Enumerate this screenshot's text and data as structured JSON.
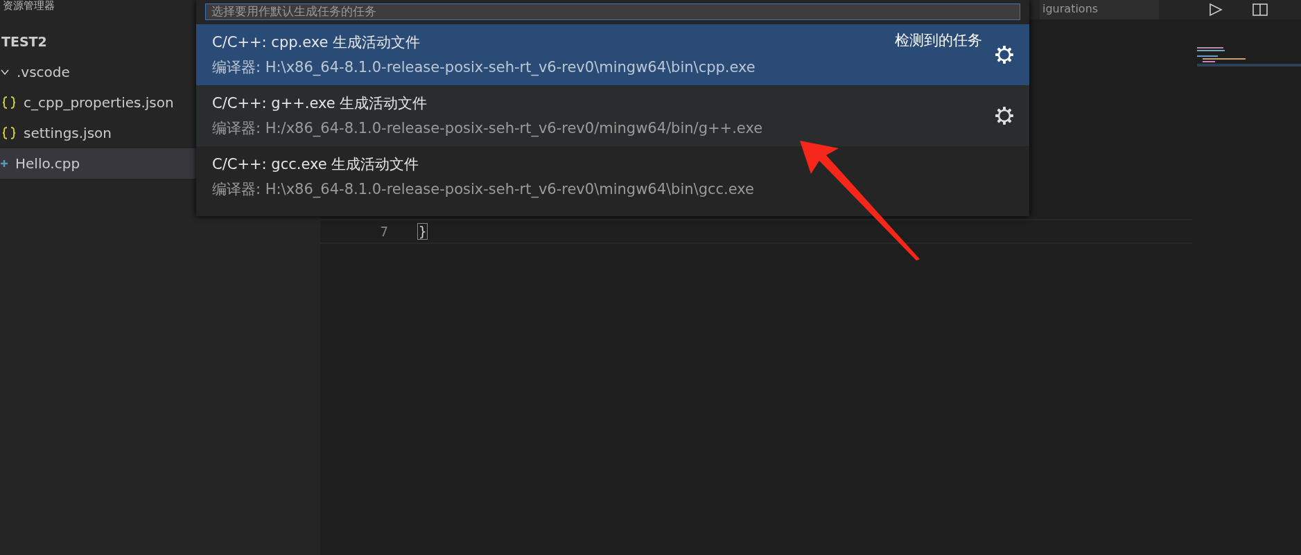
{
  "sidebar": {
    "title": "资源管理器",
    "folder": "TEST2",
    "items": [
      {
        "label": ".vscode",
        "kind": "folder",
        "expanded": true,
        "selected": false,
        "children": [
          {
            "label": "c_cpp_properties.json",
            "kind": "json",
            "selected": false
          },
          {
            "label": "settings.json",
            "kind": "json",
            "selected": false
          }
        ]
      },
      {
        "label": "Hello.cpp",
        "kind": "cpp",
        "selected": true
      }
    ]
  },
  "editor": {
    "tabs": [
      {
        "label": "igurations"
      }
    ],
    "lines": [
      {
        "number": "7",
        "text": "}"
      }
    ]
  },
  "quick_pick": {
    "placeholder": "选择要用作默认生成任务的任务",
    "items": [
      {
        "label": "C/C++: cpp.exe 生成活动文件",
        "detail": "编译器: H:\\x86_64-8.1.0-release-posix-seh-rt_v6-rev0\\mingw64\\bin\\cpp.exe",
        "group": "检测到的任务",
        "selected": true,
        "hovered": false
      },
      {
        "label": "C/C++: g++.exe 生成活动文件",
        "detail": "编译器: H:/x86_64-8.1.0-release-posix-seh-rt_v6-rev0/mingw64/bin/g++.exe",
        "selected": false,
        "hovered": true
      },
      {
        "label": "C/C++: gcc.exe 生成活动文件",
        "detail": "编译器: H:\\x86_64-8.1.0-release-posix-seh-rt_v6-rev0\\mingw64\\bin\\gcc.exe",
        "selected": false,
        "hovered": false
      }
    ]
  }
}
